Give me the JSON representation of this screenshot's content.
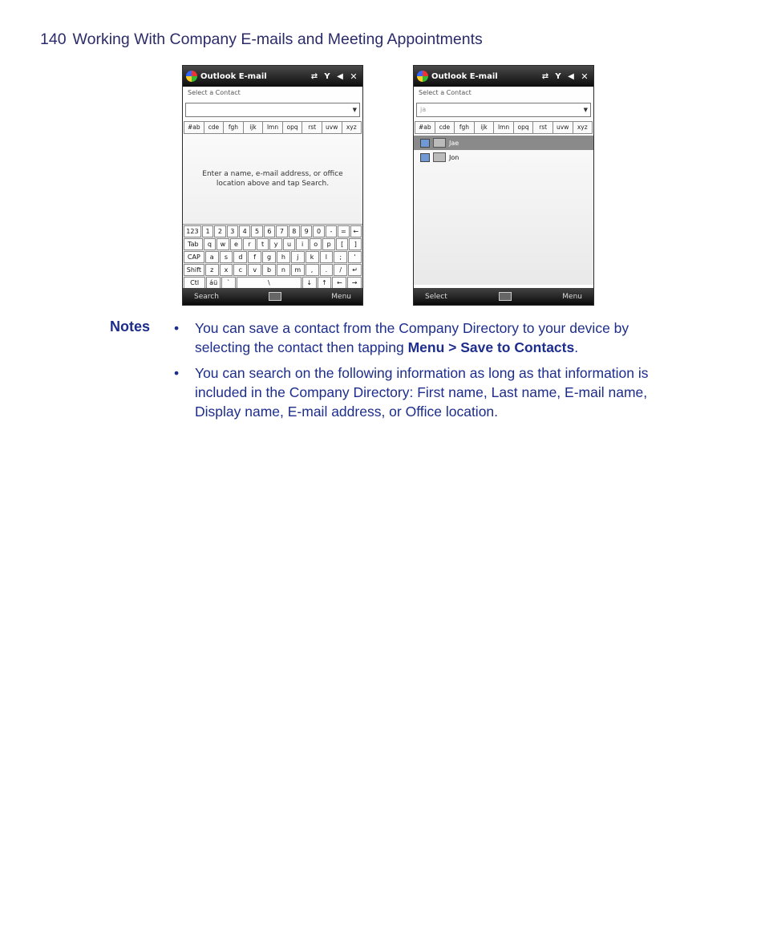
{
  "header": {
    "page_number": "140",
    "title": "Working With Company E-mails and Meeting Appointments"
  },
  "screens": {
    "left": {
      "title": "Outlook E-mail",
      "label": "Select a Contact",
      "tabs": [
        "#ab",
        "cde",
        "fgh",
        "ijk",
        "lmn",
        "opq",
        "rst",
        "uvw",
        "xyz"
      ],
      "prompt": "Enter a name, e-mail address, or office location above and tap Search.",
      "keyboard": [
        [
          "123",
          "1",
          "2",
          "3",
          "4",
          "5",
          "6",
          "7",
          "8",
          "9",
          "0",
          "-",
          "=",
          "←"
        ],
        [
          "Tab",
          "q",
          "w",
          "e",
          "r",
          "t",
          "y",
          "u",
          "i",
          "o",
          "p",
          "[",
          "]"
        ],
        [
          "CAP",
          "a",
          "s",
          "d",
          "f",
          "g",
          "h",
          "j",
          "k",
          "l",
          ";",
          "'"
        ],
        [
          "Shift",
          "z",
          "x",
          "c",
          "v",
          "b",
          "n",
          "m",
          ",",
          ".",
          "/",
          "↵"
        ],
        [
          "Ctl",
          "áü",
          "`",
          "\\",
          "↓",
          "↑",
          "←",
          "→"
        ]
      ],
      "softkey_left": "Search",
      "softkey_right": "Menu"
    },
    "right": {
      "title": "Outlook E-mail",
      "label": "Select a Contact",
      "search_value": "ja",
      "tabs": [
        "#ab",
        "cde",
        "fgh",
        "ijk",
        "lmn",
        "opq",
        "rst",
        "uvw",
        "xyz"
      ],
      "results": [
        "Jae",
        "Jon"
      ],
      "softkey_left": "Select",
      "softkey_right": "Menu"
    }
  },
  "notes": {
    "label": "Notes",
    "bullet": "•",
    "item1_a": "You can save a contact from the Company Directory to your device by selecting the contact then tapping ",
    "item1_bold": "Menu > Save to Contacts",
    "item1_b": ".",
    "item2": "You can search on the following information as long as that information is included in the Company Directory: First name, Last name, E-mail name, Display name, E-mail address, or Office location."
  }
}
